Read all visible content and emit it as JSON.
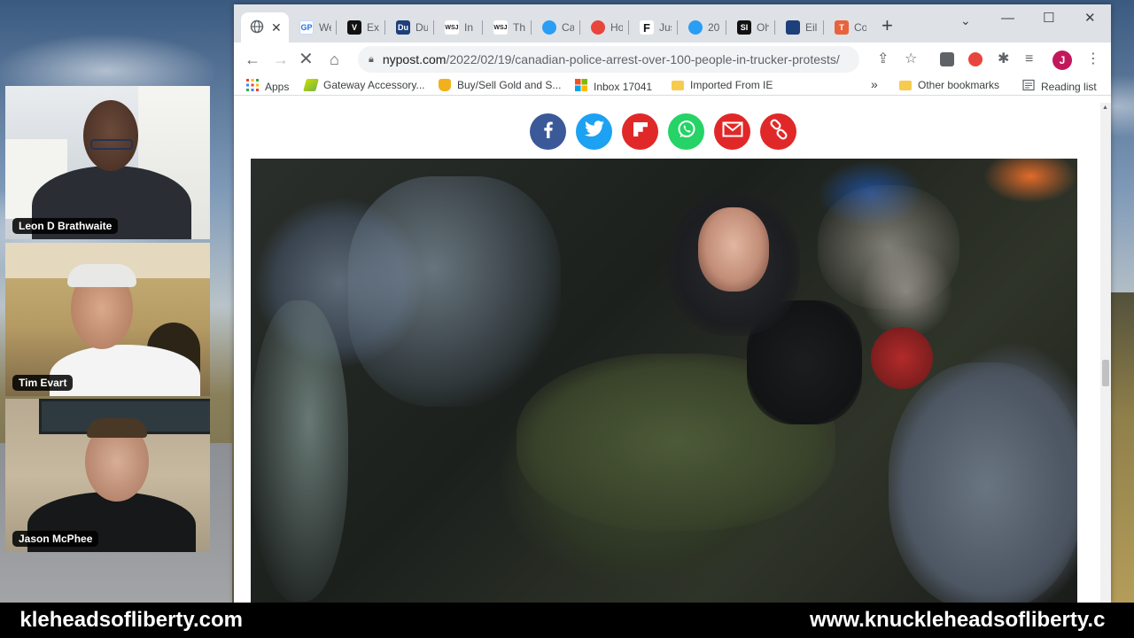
{
  "browser": {
    "tabs": [
      {
        "favicon": "globe-icon",
        "label": "",
        "active": true,
        "color": "#5f6368"
      },
      {
        "favicon": "GP",
        "label": "We",
        "color": "#1a73e8"
      },
      {
        "favicon": "V",
        "label": "Exc",
        "color": "#111111"
      },
      {
        "favicon": "Du",
        "label": "Du",
        "color": "#1d3f7a"
      },
      {
        "favicon": "WSJ",
        "label": "In",
        "color": "#222222"
      },
      {
        "favicon": "WSJ",
        "label": "Th",
        "color": "#222222"
      },
      {
        "favicon": "Ca",
        "label": "Ca",
        "color": "#2a9df4"
      },
      {
        "favicon": "Ho",
        "label": "Ho",
        "color": "#e8453c"
      },
      {
        "favicon": "F",
        "label": "Jus",
        "color": "#111111"
      },
      {
        "favicon": "20",
        "label": "20",
        "color": "#2a9df4"
      },
      {
        "favicon": "SI",
        "label": "Oh",
        "color": "#111111"
      },
      {
        "favicon": "Eil",
        "label": "Eil",
        "color": "#1d3f7a"
      },
      {
        "favicon": "T",
        "label": "Co",
        "color": "#e8633c"
      }
    ],
    "url_host": "nypost.com",
    "url_path": "/2022/02/19/canadian-police-arrest-over-100-people-in-trucker-protests/",
    "avatar_letter": "J",
    "bookmarks": [
      {
        "label": "Apps",
        "icon": "apps-grid-icon"
      },
      {
        "label": "Gateway Accessory...",
        "icon": "gateway-icon"
      },
      {
        "label": "Buy/Sell Gold and S...",
        "icon": "gold-icon"
      },
      {
        "label": "Inbox 17041",
        "icon": "microsoft-icon"
      },
      {
        "label": "Imported From IE",
        "icon": "folder-icon"
      }
    ],
    "bookmarks_overflow": "»",
    "other_bookmarks": "Other bookmarks",
    "reading_list": "Reading list"
  },
  "share_buttons": [
    {
      "name": "facebook",
      "color": "#3b5998"
    },
    {
      "name": "twitter",
      "color": "#1da1f2"
    },
    {
      "name": "flipboard",
      "color": "#e12828"
    },
    {
      "name": "whatsapp",
      "color": "#25d366"
    },
    {
      "name": "email",
      "color": "#e12828"
    },
    {
      "name": "copy-link",
      "color": "#e12828"
    }
  ],
  "participants": [
    {
      "name": "Leon D Brathwaite"
    },
    {
      "name": "Tim Evart"
    },
    {
      "name": "Jason McPhee"
    }
  ],
  "banner": {
    "left_text": "kleheadsofliberty.com",
    "right_text": "www.knuckleheadsofliberty.c"
  }
}
